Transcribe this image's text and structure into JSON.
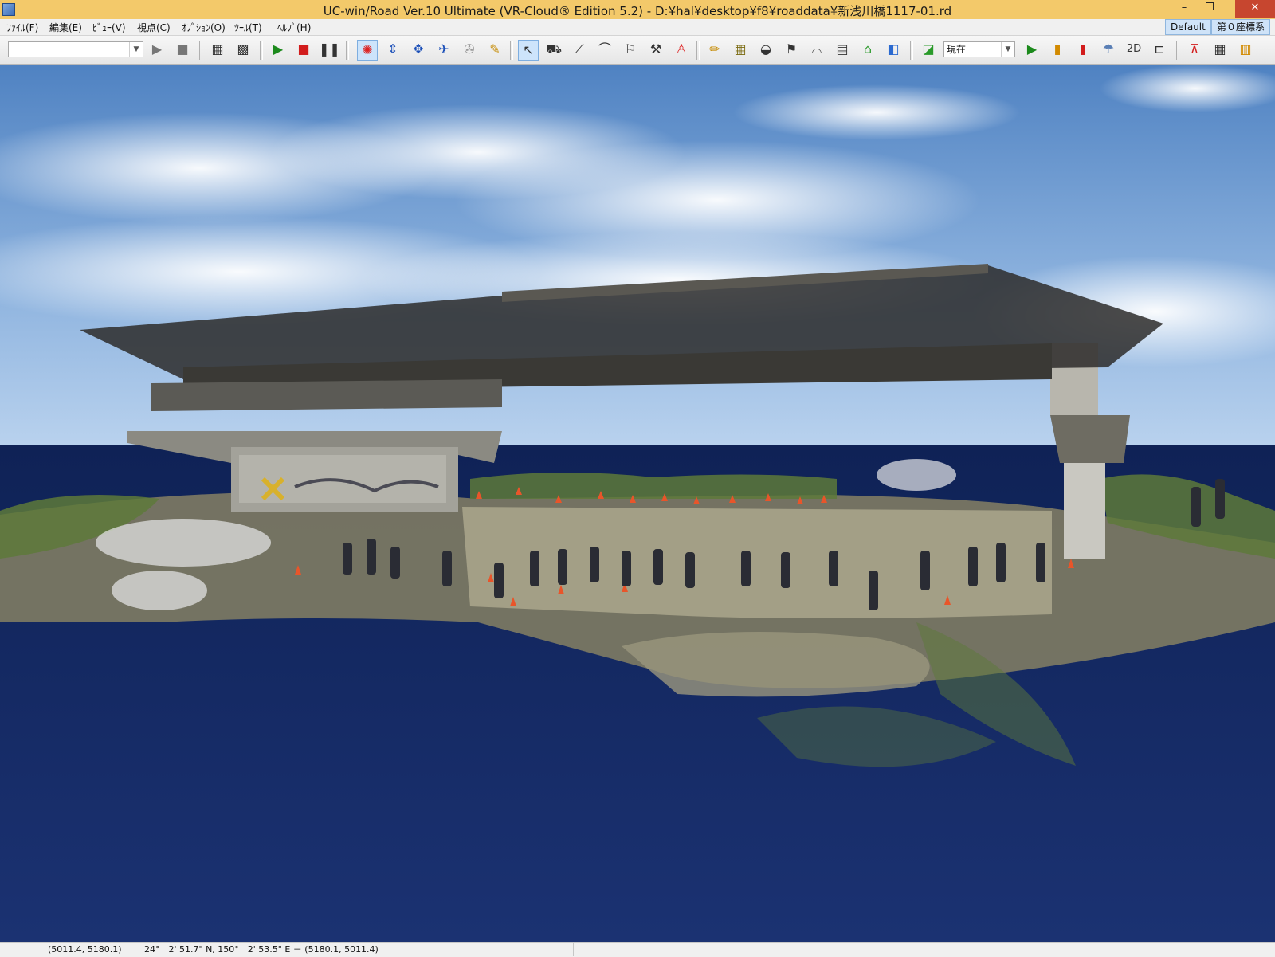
{
  "window": {
    "title": "UC-win/Road Ver.10 Ultimate (VR-Cloud® Edition 5.2) - D:¥hal¥desktop¥f8¥roaddata¥新浅川橋1117-01.rd",
    "minimize": "–",
    "maximize": "❐",
    "close": "✕"
  },
  "menu": {
    "items": [
      "ﾌｧｲﾙ(F)",
      "編集(E)",
      "ﾋﾞｭｰ(V)",
      "視点(C)",
      "ｵﾌﾟｼｮﾝ(O)",
      "ﾂｰﾙ(T)",
      "ﾍﾙﾌﾟ(H)"
    ],
    "default_tag": "Default",
    "coord_tag": "第０座標系"
  },
  "toolbar": {
    "scenario_value": "",
    "time_value": "現在",
    "mode_2d_label": "2D"
  },
  "icons": {
    "play": "play-icon",
    "stop": "stop-icon",
    "orbit": "orbit-icon",
    "select": "pointer-icon"
  },
  "colors": {
    "titlebar": "#f3c96a",
    "close": "#c7462f",
    "active": "#cde4fb",
    "sea": "#1a2e66"
  },
  "status": {
    "xy": "(5011.4, 5180.1)",
    "geo": "24°　2' 51.7\" N, 150°　2' 53.5\" E － (5180.1, 5011.4)"
  }
}
